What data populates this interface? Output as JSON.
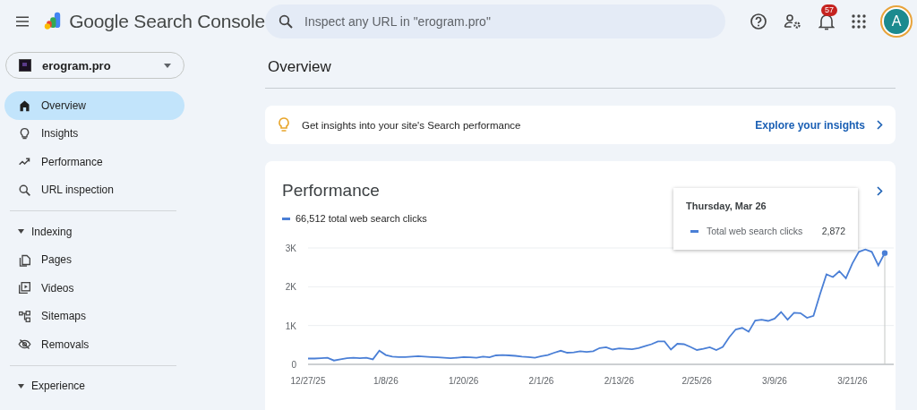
{
  "app": {
    "title": "Google Search Console",
    "search": {
      "placeholder": "Inspect any URL in \"erogram.pro\""
    },
    "notifications": "57",
    "avatar": "A"
  },
  "property": {
    "name": "erogram.pro"
  },
  "sidebar": {
    "items": [
      {
        "kind": "item",
        "label": "Overview",
        "selected": true
      },
      {
        "kind": "item",
        "label": "Insights",
        "selected": false
      },
      {
        "kind": "item",
        "label": "Performance",
        "selected": false
      },
      {
        "kind": "item",
        "label": "URL inspection",
        "selected": false
      },
      {
        "kind": "section",
        "label": "Indexing",
        "expanded": true,
        "children": [
          {
            "kind": "item",
            "label": "Pages",
            "selected": false
          },
          {
            "kind": "item",
            "label": "Videos",
            "selected": false
          },
          {
            "kind": "item",
            "label": "Sitemaps",
            "selected": false
          },
          {
            "kind": "item",
            "label": "Removals",
            "selected": false
          }
        ]
      },
      {
        "kind": "section",
        "label": "Experience",
        "expanded": true
      }
    ]
  },
  "page": {
    "title": "Overview"
  },
  "insight": {
    "text": "Get insights into your site's Search performance",
    "link": "Explore your insights"
  },
  "performance": {
    "title": "Performance",
    "legend": "66,512 total web search clicks",
    "tooltip": {
      "date": "Thursday, Mar 26",
      "value": "2,872"
    },
    "chart_data": {
      "type": "line",
      "ylim": [
        0,
        3000
      ],
      "yticks": [
        {
          "value": 0,
          "label": "0"
        },
        {
          "value": 1000,
          "label": "1K"
        },
        {
          "value": 2000,
          "label": "2K"
        },
        {
          "value": 3000,
          "label": "3K"
        }
      ],
      "categories": [
        "12/27/25",
        null,
        null,
        null,
        null,
        null,
        null,
        null,
        null,
        null,
        null,
        null,
        "1/8/26",
        null,
        null,
        null,
        null,
        null,
        null,
        null,
        null,
        null,
        null,
        null,
        "1/20/26",
        null,
        null,
        null,
        null,
        null,
        null,
        null,
        null,
        null,
        null,
        null,
        "2/1/26",
        null,
        null,
        null,
        null,
        null,
        null,
        null,
        null,
        null,
        null,
        null,
        "2/13/26",
        null,
        null,
        null,
        null,
        null,
        null,
        null,
        null,
        null,
        null,
        null,
        "2/25/26",
        null,
        null,
        null,
        null,
        null,
        null,
        null,
        null,
        null,
        null,
        null,
        "3/9/26",
        null,
        null,
        null,
        null,
        null,
        null,
        null,
        null,
        null,
        null,
        null,
        "3/21/26",
        null,
        null,
        null,
        null,
        null
      ],
      "series": [
        {
          "name": "Total web search clicks",
          "color": "#4a7fd6",
          "values": [
            150,
            150,
            160,
            170,
            100,
            130,
            160,
            170,
            160,
            170,
            130,
            350,
            240,
            200,
            190,
            190,
            200,
            210,
            200,
            190,
            180,
            170,
            160,
            170,
            190,
            180,
            170,
            200,
            180,
            230,
            240,
            230,
            220,
            200,
            190,
            170,
            210,
            240,
            300,
            350,
            300,
            310,
            340,
            320,
            340,
            420,
            440,
            380,
            410,
            400,
            390,
            420,
            470,
            520,
            590,
            590,
            380,
            530,
            520,
            450,
            370,
            400,
            440,
            370,
            450,
            700,
            900,
            940,
            840,
            1130,
            1150,
            1120,
            1180,
            1350,
            1150,
            1330,
            1320,
            1200,
            1250,
            1800,
            2320,
            2250,
            2400,
            2220,
            2600,
            2900,
            2960,
            2900,
            2550,
            2870
          ]
        }
      ]
    }
  }
}
